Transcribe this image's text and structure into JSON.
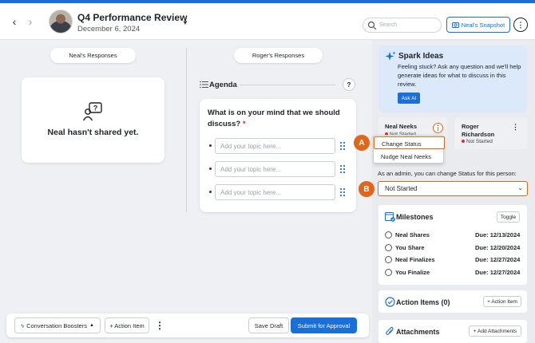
{
  "colors": {
    "accent": "#1b6fd6",
    "callout": "#e0661b",
    "status_not_started": "#d93025",
    "spark_bg": "#dbe9fb"
  },
  "header": {
    "title": "Q4 Performance Review",
    "date": "December 6, 2024",
    "search_placeholder": "Search",
    "snapshot_button": "Neal's Snapshot",
    "icons": [
      "back-arrow-icon",
      "forward-arrow-icon",
      "chevron-down-icon",
      "search-icon",
      "snapshot-icon",
      "more-vertical-icon"
    ]
  },
  "responses": {
    "neal_tab": "Neal's Responses",
    "roger_tab": "Roger's Responses",
    "empty_message": "Neal hasn't shared yet."
  },
  "agenda": {
    "title": "Agenda",
    "help": "?",
    "question": "What is on your mind that we should discuss?",
    "required_mark": "*",
    "topics": [
      {
        "placeholder": "Add your topic here..."
      },
      {
        "placeholder": "Add your topic here..."
      },
      {
        "placeholder": "Add your topic here..."
      }
    ]
  },
  "bottombar": {
    "boosters": "Conversation Boosters",
    "add_action": "+ Action Item",
    "save_draft": "Save Draft",
    "submit": "Submit for Approval"
  },
  "sidebar": {
    "spark": {
      "title": "Spark Ideas",
      "text": "Feeling stuck? Ask any question and we'll help generate ideas for what to discuss in this review.",
      "ask_button": "Ask AI"
    },
    "people": [
      {
        "name": "Neal Neeks",
        "status": "Not Started"
      },
      {
        "name": "Roger Richardson",
        "status": "Not Started"
      }
    ],
    "context_menu": {
      "items": [
        "Change Status",
        "Nudge Neal Neeks"
      ]
    },
    "callouts": {
      "a": "A",
      "b": "B"
    },
    "admin_note": "As an admin, you can change Status for this person:",
    "status_select": "Not Started",
    "milestones": {
      "title": "Milestones",
      "toggle": "Toggle",
      "rows": [
        {
          "label": "Neal Shares",
          "due": "Due: 12/13/2024"
        },
        {
          "label": "You Share",
          "due": "Due: 12/20/2024"
        },
        {
          "label": "Neal Finalizes",
          "due": "Due: 12/27/2024"
        },
        {
          "label": "You Finalize",
          "due": "Due: 12/27/2024"
        }
      ]
    },
    "action_items": {
      "title": "Action Items (0)",
      "add": "+ Action Item"
    },
    "attachments": {
      "title": "Attachments",
      "add": "+ Add Attachments"
    }
  }
}
